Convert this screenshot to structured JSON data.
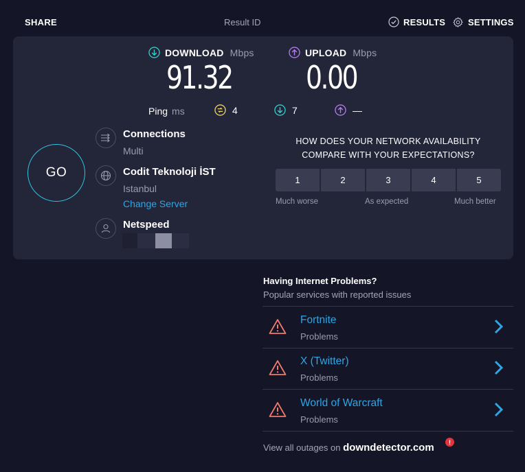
{
  "header": {
    "share": "SHARE",
    "result_id": "Result ID",
    "results": "RESULTS",
    "settings": "SETTINGS"
  },
  "download": {
    "label": "DOWNLOAD",
    "unit": "Mbps",
    "value": "91.32"
  },
  "upload": {
    "label": "UPLOAD",
    "unit": "Mbps",
    "value": "0.00"
  },
  "ping": {
    "label": "Ping",
    "unit": "ms",
    "idle": "4",
    "download": "7",
    "upload": "—"
  },
  "go": "GO",
  "connections": {
    "label": "Connections",
    "value": "Multi"
  },
  "server": {
    "name": "Codit Teknoloji İST",
    "city": "Istanbul",
    "change": "Change Server"
  },
  "provider": {
    "name": "Netspeed"
  },
  "survey": {
    "question": "HOW DOES YOUR NETWORK AVAILABILITY COMPARE WITH YOUR EXPECTATIONS?",
    "options": [
      "1",
      "2",
      "3",
      "4",
      "5"
    ],
    "low": "Much worse",
    "mid": "As expected",
    "high": "Much better"
  },
  "problems": {
    "title": "Having Internet Problems?",
    "subtitle": "Popular services with reported issues",
    "items": [
      {
        "service": "Fortnite",
        "status": "Problems"
      },
      {
        "service": "X (Twitter)",
        "status": "Problems"
      },
      {
        "service": "World of Warcraft",
        "status": "Problems"
      }
    ],
    "footer_text": "View all outages on",
    "footer_brand": "downdetector.com"
  },
  "colors": {
    "background": "#141526",
    "panel": "#232539",
    "accent_cyan": "#2fc6e0",
    "download_icon": "#2fd0c8",
    "upload_icon": "#b57bf0",
    "ping_icon": "#f0d45b",
    "link": "#2ea6e6",
    "warning": "#f07a6a"
  },
  "icons": {
    "results": "check-circle-icon",
    "settings": "gear-icon",
    "download": "arrow-down-circle-icon",
    "upload": "arrow-up-circle-icon",
    "ping_idle": "idle-latency-icon",
    "connections": "connections-icon",
    "server": "globe-icon",
    "provider": "user-icon",
    "warning": "warning-triangle-icon",
    "chevron": "chevron-right-icon"
  }
}
